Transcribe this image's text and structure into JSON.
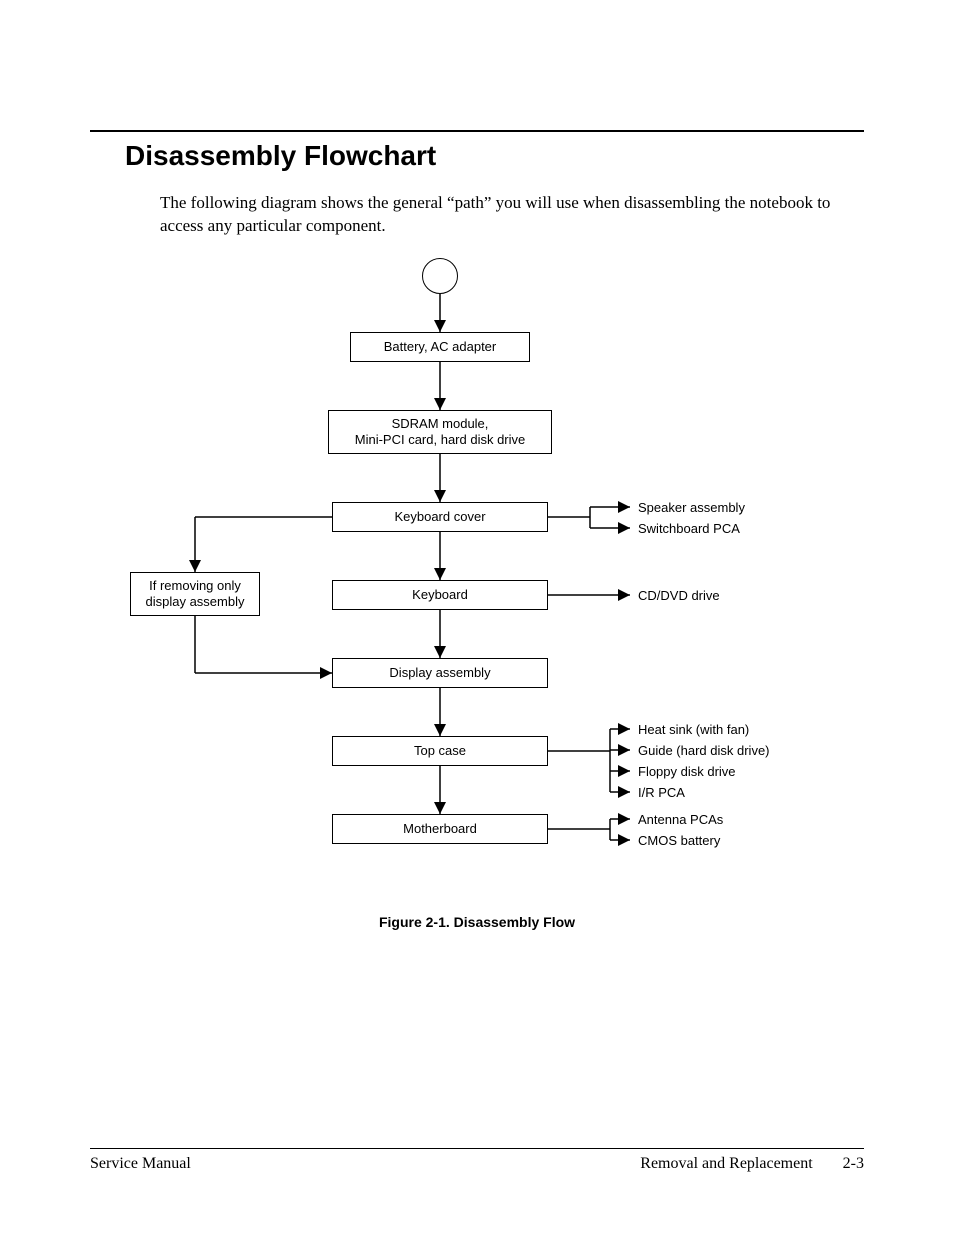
{
  "heading": "Disassembly Flowchart",
  "intro": "The following diagram shows the general “path” you will use when disassembling the notebook to access any particular component.",
  "caption": "Figure 2-1. Disassembly Flow",
  "nodes": {
    "battery": "Battery, AC adapter",
    "sdram": "SDRAM module,\nMini-PCI card, hard disk drive",
    "kbcover": "Keyboard cover",
    "keyboard": "Keyboard",
    "display": "Display assembly",
    "topcase": "Top case",
    "mobo": "Motherboard",
    "ifremoving": "If removing only\ndisplay assembly"
  },
  "side": {
    "speaker": "Speaker assembly",
    "switchboard": "Switchboard PCA",
    "cddvd": "CD/DVD drive",
    "heatsink": "Heat sink (with fan)",
    "guide": "Guide (hard disk drive)",
    "floppy": "Floppy disk drive",
    "irpca": "I/R PCA",
    "antenna": "Antenna PCAs",
    "cmos": "CMOS battery"
  },
  "footer": {
    "left": "Service Manual",
    "section": "Removal and Replacement",
    "page": "2-3"
  }
}
